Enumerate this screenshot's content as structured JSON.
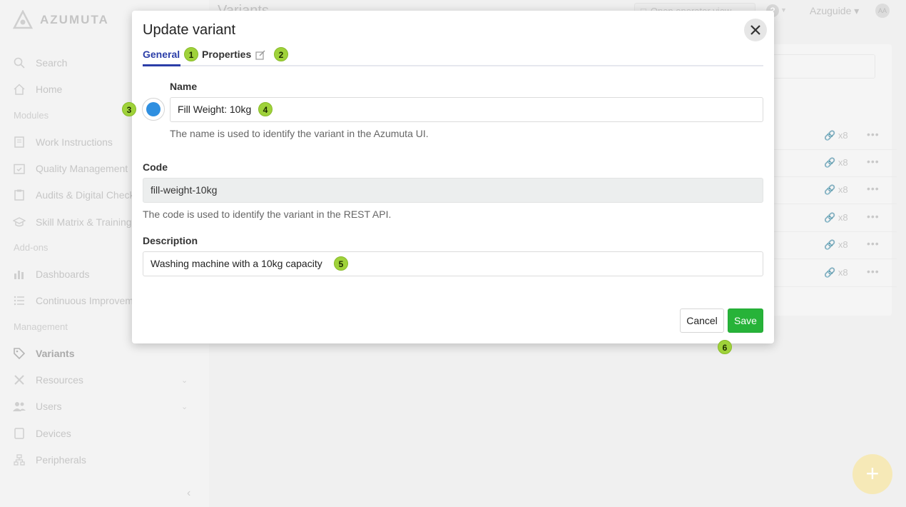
{
  "app": {
    "logo_text": "AZUMUTA",
    "page_title": "Variants",
    "open_operator_view": "Open operator view",
    "org_name": "Azuguide",
    "avatar_initials": "AA"
  },
  "sidebar": {
    "search": "Search",
    "home": "Home",
    "sections": {
      "modules": "Modules",
      "addons": "Add-ons",
      "management": "Management"
    },
    "modules": [
      "Work Instructions",
      "Quality Management",
      "Audits & Digital Checklists",
      "Skill Matrix & Training"
    ],
    "addons": [
      "Dashboards",
      "Continuous Improvement"
    ],
    "management": [
      "Variants",
      "Resources",
      "Users",
      "Devices",
      "Peripherals"
    ]
  },
  "table": {
    "rows": [
      {
        "links": "x8"
      },
      {
        "links": "x8"
      },
      {
        "links": "x8"
      },
      {
        "links": "x8"
      },
      {
        "links": "x8"
      },
      {
        "links": "x8"
      }
    ]
  },
  "modal": {
    "title": "Update variant",
    "tabs": {
      "general": "General",
      "properties": "Properties"
    },
    "name": {
      "label": "Name",
      "value": "Fill Weight: 10kg",
      "help": "The name is used to identify the variant in the Azumuta UI.",
      "color": "#2f8fe0"
    },
    "code": {
      "label": "Code",
      "value": "fill-weight-10kg",
      "help": "The code is used to identify the variant in the REST API."
    },
    "description": {
      "label": "Description",
      "value": "Washing machine with a 10kg capacity"
    },
    "buttons": {
      "cancel": "Cancel",
      "save": "Save"
    }
  },
  "annotations": [
    "1",
    "2",
    "3",
    "4",
    "5",
    "6"
  ],
  "colors": {
    "accent": "#2b3ea8",
    "save_green": "#27b339",
    "badge_green": "#9fd23a"
  }
}
